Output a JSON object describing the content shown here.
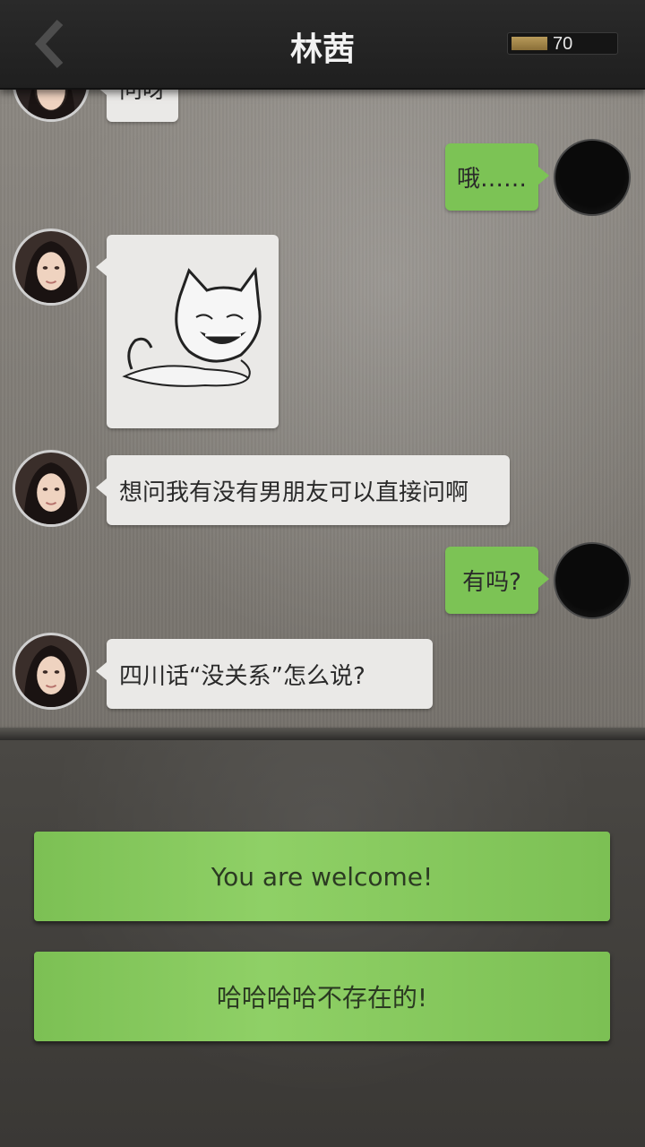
{
  "header": {
    "back_icon": "chevron-left-icon",
    "title": "林茜",
    "coins": "70"
  },
  "messages": [
    {
      "side": "left",
      "text": "问呀",
      "partial": true
    },
    {
      "side": "right",
      "text": "哦……"
    },
    {
      "side": "left",
      "type": "sticker",
      "sticker": "grinning-cat-meme-sticker"
    },
    {
      "side": "left",
      "text": "想问我有没有男朋友可以直接问啊"
    },
    {
      "side": "right",
      "text": "有吗?"
    },
    {
      "side": "left",
      "text": "四川话“没关系”怎么说?"
    }
  ],
  "choices": [
    {
      "label": "You are welcome!"
    },
    {
      "label": "哈哈哈哈不存在的!"
    }
  ],
  "colors": {
    "header_bg": "#232323",
    "sent_bubble": "#7cc355",
    "received_bubble": "#eae9e7",
    "choice_button": "#86c95c"
  }
}
